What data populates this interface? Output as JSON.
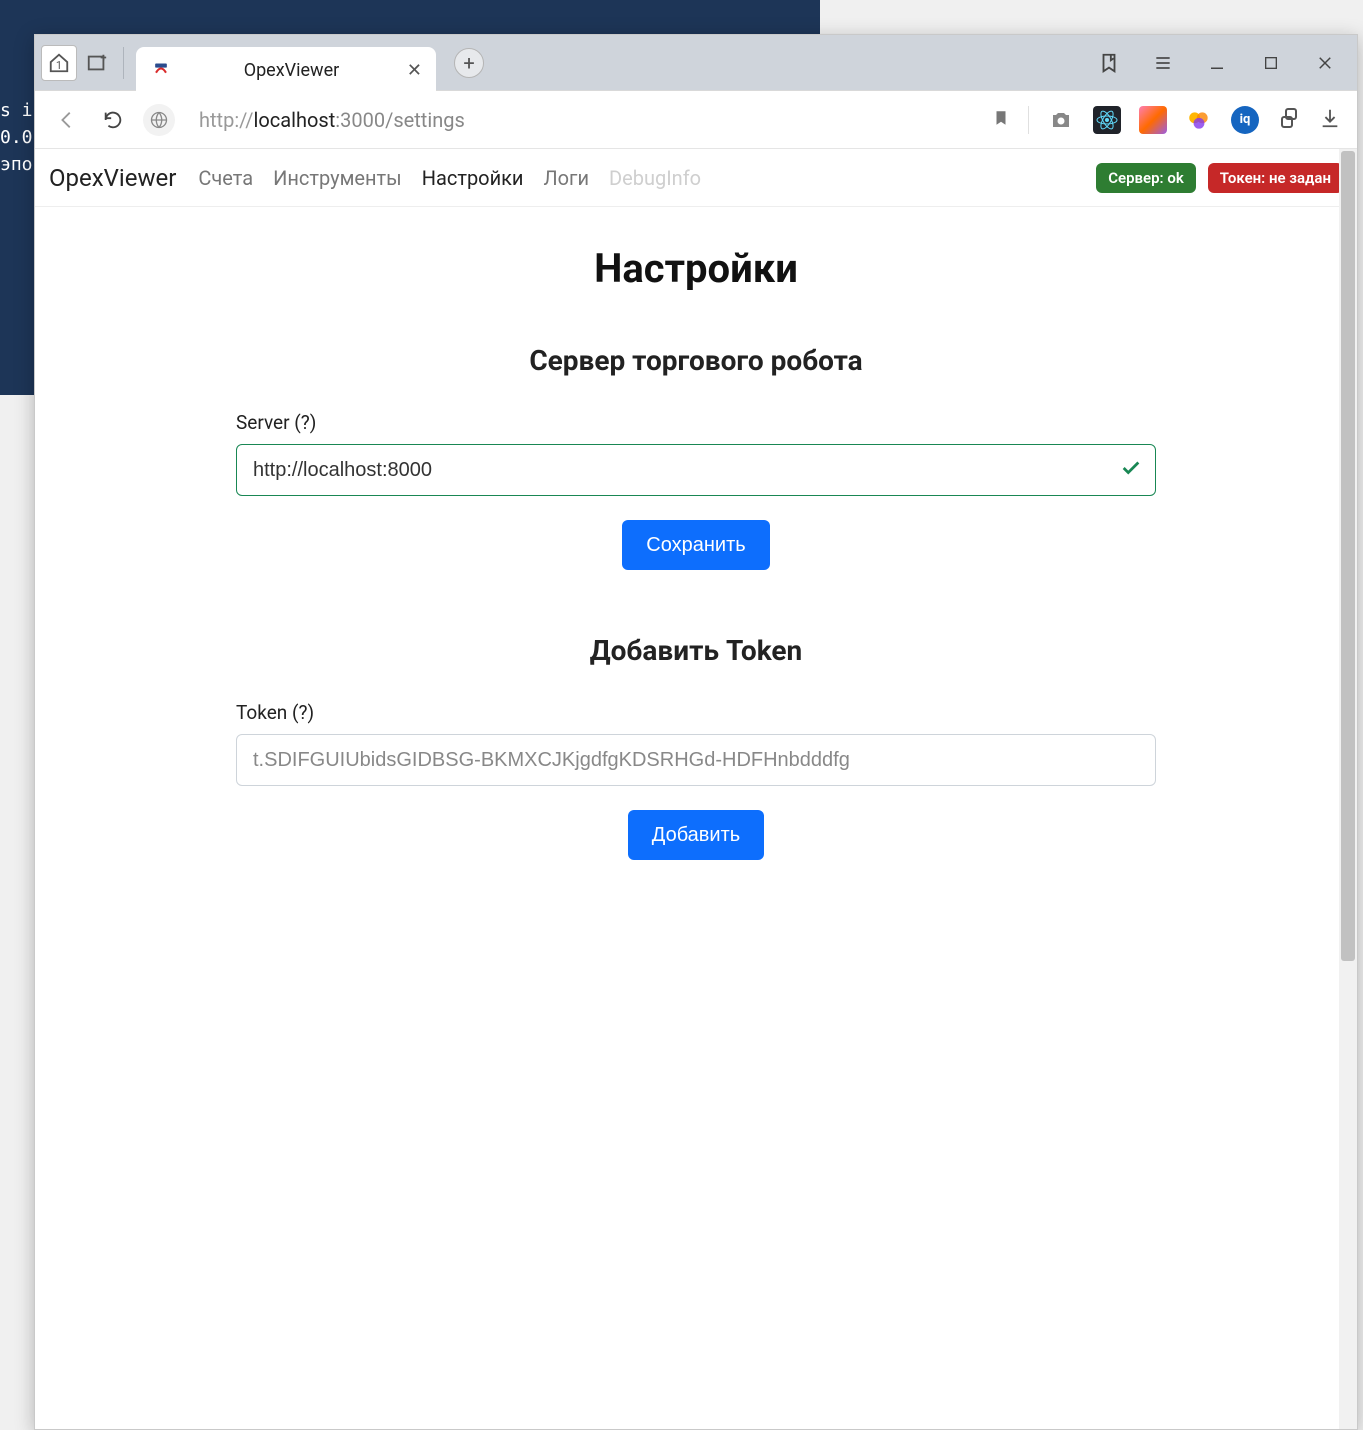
{
  "background_terminal": {
    "line1": "s i",
    "line2": "0.0",
    "line3": "эпо"
  },
  "browser": {
    "app_home_badge": "1",
    "tab": {
      "title": "OpexViewer"
    },
    "url_prefix": "http://",
    "url_host": "localhost",
    "url_port_path": ":3000/settings"
  },
  "nav": {
    "brand": "OpexViewer",
    "items": [
      "Счета",
      "Инструменты",
      "Настройки",
      "Логи",
      "DebugInfo"
    ],
    "active_index": 2,
    "muted_index": 4,
    "server_badge": "Сервер: ok",
    "token_badge": "Токен: не задан"
  },
  "page": {
    "title": "Настройки",
    "server_section_title": "Сервер торгового робота",
    "server_label": "Server (?)",
    "server_value": "http://localhost:8000",
    "save_button": "Сохранить",
    "token_section_title": "Добавить Token",
    "token_label": "Token (?)",
    "token_placeholder": "t.SDIFGUIUbidsGIDBSG-BKMXCJKjgdfgKDSRHGd-HDFHnbdddfg",
    "add_button": "Добавить"
  }
}
